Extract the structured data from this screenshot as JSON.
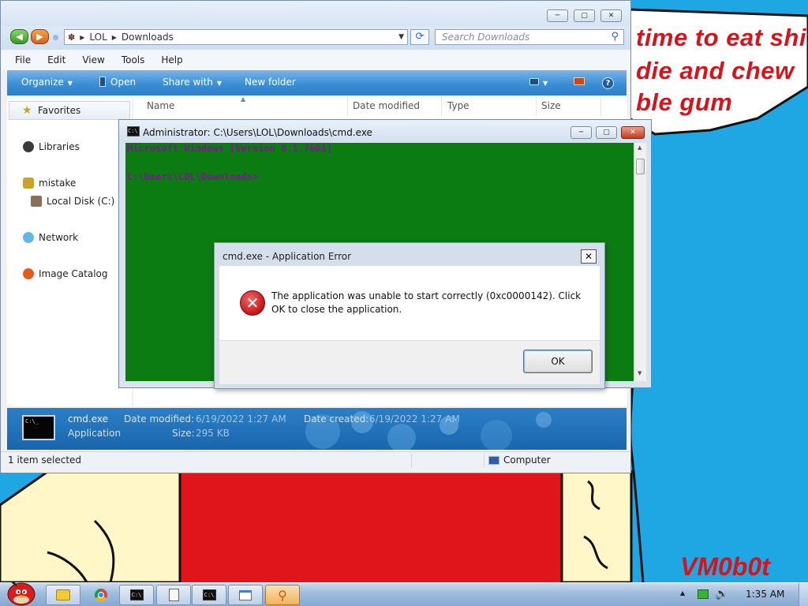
{
  "desktop": {
    "bubble_lines": [
      "time to eat shit",
      "die and chew",
      "ble gum"
    ],
    "watermark": "VM0b0t",
    "colors": {
      "sky": "#1fa7e4",
      "shirt": "#e0151b",
      "text": "#d6121b"
    }
  },
  "explorer": {
    "window_controls": [
      "minimize-icon",
      "maximize-icon",
      "close-icon"
    ],
    "breadcrumb": [
      "LOL",
      "Downloads"
    ],
    "search_placeholder": "Search Downloads",
    "menu": [
      "File",
      "Edit",
      "View",
      "Tools",
      "Help"
    ],
    "commands": {
      "organize": "Organize",
      "open": "Open",
      "share_with": "Share with",
      "new_folder": "New folder"
    },
    "nav": {
      "favorites": "Favorites",
      "libraries": "Libraries",
      "homegroup": "mistake",
      "local_disk": "Local Disk (C:)",
      "network": "Network",
      "image_catalog": "Image Catalog"
    },
    "columns": [
      "Name",
      "Date modified",
      "Type",
      "Size"
    ],
    "details": {
      "file_name": "cmd.exe",
      "file_type": "Application",
      "date_modified_label": "Date modified:",
      "date_modified_value": "6/19/2022 1:27 AM",
      "size_label": "Size:",
      "size_value": "295 KB",
      "date_created_label": "Date created:",
      "date_created_value": "6/19/2022 1:27 AM"
    },
    "status": {
      "selection": "1 item selected",
      "zone": "Computer"
    }
  },
  "cmd_window": {
    "title": "Administrator: C:\\Users\\LOL\\Downloads\\cmd.exe",
    "lines": [
      "Microsoft Windows [Version 6.1.7601]",
      "",
      "C:\\Users\\LOL\\Downloads>"
    ],
    "colors": {
      "background": "#0b7c12",
      "text": "#7c1890"
    }
  },
  "error_dialog": {
    "title": "cmd.exe - Application Error",
    "message": "The application was unable to start correctly (0xc0000142). Click OK to close the application.",
    "ok_label": "OK",
    "icon": "error-icon"
  },
  "taskbar": {
    "start_icon": "angry-bird-start-icon",
    "pinned": [
      "explorer-icon",
      "chrome-icon",
      "cmd-icon",
      "notepad-icon",
      "cmd-icon",
      "window-icon",
      "search-icon"
    ],
    "tray": [
      "show-hidden-icons",
      "network-icon",
      "volume-icon"
    ],
    "clock": "1:35 AM"
  }
}
